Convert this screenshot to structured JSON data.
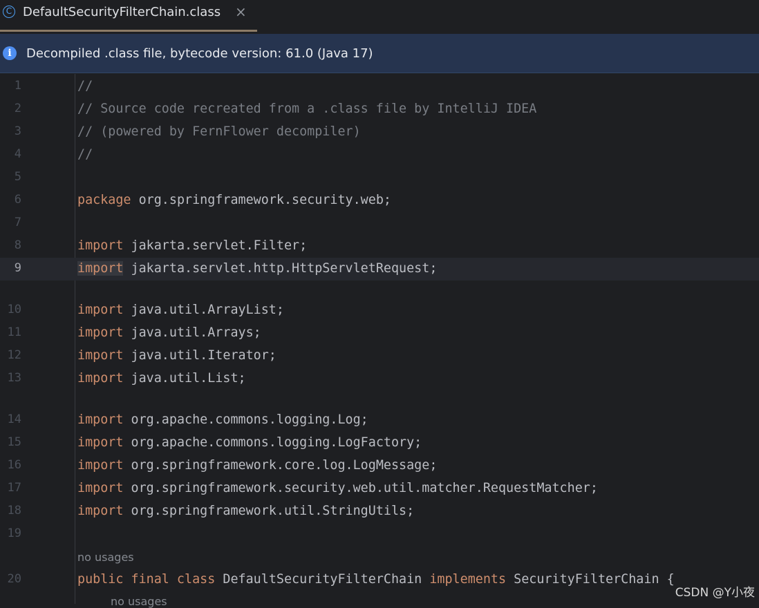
{
  "tab": {
    "title": "DefaultSecurityFilterChain.class",
    "close_glyph": "×",
    "icon": "class-icon",
    "icon_glyph": "C"
  },
  "banner": {
    "text": "Decompiled .class file, bytecode version: 61.0 (Java 17)",
    "icon": "info-icon",
    "icon_glyph": "i"
  },
  "editor": {
    "lines": [
      {
        "n": "1",
        "parts": [
          {
            "t": "//",
            "k": "cm"
          }
        ]
      },
      {
        "n": "2",
        "parts": [
          {
            "t": "// Source code recreated from a .class file by IntelliJ IDEA",
            "k": "cm"
          }
        ]
      },
      {
        "n": "3",
        "parts": [
          {
            "t": "// (powered by FernFlower decompiler)",
            "k": "cm"
          }
        ]
      },
      {
        "n": "4",
        "parts": [
          {
            "t": "//",
            "k": "cm"
          }
        ]
      },
      {
        "n": "5",
        "parts": []
      },
      {
        "n": "6",
        "parts": [
          {
            "t": "package",
            "k": "kw"
          },
          {
            "t": " org.springframework.security.web;",
            "k": ""
          }
        ]
      },
      {
        "n": "7",
        "parts": []
      },
      {
        "n": "8",
        "parts": [
          {
            "t": "import",
            "k": "kw"
          },
          {
            "t": " jakarta.servlet.Filter;",
            "k": ""
          }
        ]
      },
      {
        "n": "9",
        "parts": [
          {
            "t": "import",
            "k": "kw kw-hl"
          },
          {
            "t": " jakarta.servlet.http.HttpServletRequest;",
            "k": ""
          }
        ]
      },
      {
        "n": "10",
        "parts": [
          {
            "t": "import",
            "k": "kw"
          },
          {
            "t": " java.util.ArrayList;",
            "k": ""
          }
        ]
      },
      {
        "n": "11",
        "parts": [
          {
            "t": "import",
            "k": "kw"
          },
          {
            "t": " java.util.Arrays;",
            "k": ""
          }
        ]
      },
      {
        "n": "12",
        "parts": [
          {
            "t": "import",
            "k": "kw"
          },
          {
            "t": " java.util.Iterator;",
            "k": ""
          }
        ]
      },
      {
        "n": "13",
        "parts": [
          {
            "t": "import",
            "k": "kw"
          },
          {
            "t": " java.util.List;",
            "k": ""
          }
        ]
      },
      {
        "n": "14",
        "parts": [
          {
            "t": "import",
            "k": "kw"
          },
          {
            "t": " org.apache.commons.logging.Log;",
            "k": ""
          }
        ]
      },
      {
        "n": "15",
        "parts": [
          {
            "t": "import",
            "k": "kw"
          },
          {
            "t": " org.apache.commons.logging.LogFactory;",
            "k": ""
          }
        ]
      },
      {
        "n": "16",
        "parts": [
          {
            "t": "import",
            "k": "kw"
          },
          {
            "t": " org.springframework.core.log.LogMessage;",
            "k": ""
          }
        ]
      },
      {
        "n": "17",
        "parts": [
          {
            "t": "import",
            "k": "kw"
          },
          {
            "t": " org.springframework.security.web.util.matcher.RequestMatcher;",
            "k": ""
          }
        ]
      },
      {
        "n": "18",
        "parts": [
          {
            "t": "import",
            "k": "kw"
          },
          {
            "t": " org.springframework.util.StringUtils;",
            "k": ""
          }
        ]
      },
      {
        "n": "19",
        "parts": []
      },
      {
        "n": "20",
        "parts": [
          {
            "t": "public final class",
            "k": "kw"
          },
          {
            "t": " DefaultSecurityFilterChain ",
            "k": ""
          },
          {
            "t": "implements",
            "k": "kw"
          },
          {
            "t": " SecurityFilterChain {",
            "k": ""
          }
        ]
      }
    ],
    "hints": [
      "no usages",
      "no usages"
    ],
    "caret_line": "9"
  },
  "watermark": "CSDN @Y小夜",
  "colors": {
    "background": "#1e1f22",
    "keyword": "#cf8e6d",
    "comment": "#7a7e85",
    "text": "#bcbec4",
    "banner": "#26344f",
    "tab_underline": "#8c7b67"
  }
}
